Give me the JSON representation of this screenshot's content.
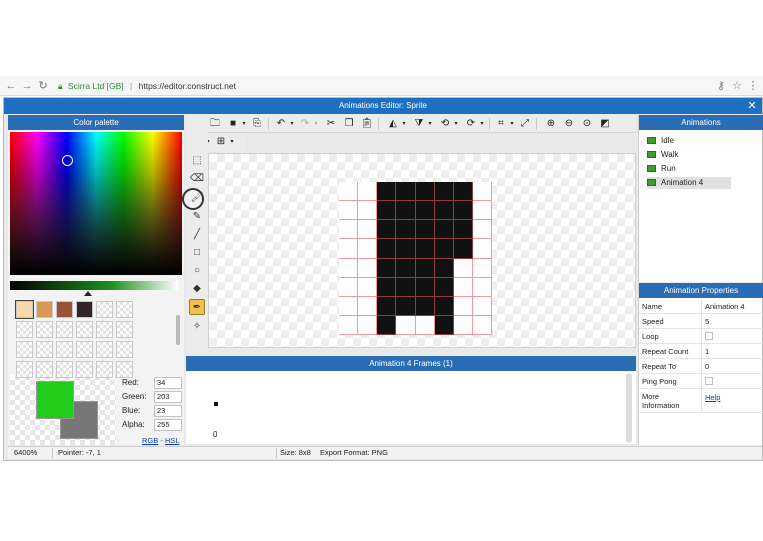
{
  "browser": {
    "org": "Scirra Ltd [GB]",
    "url": "https://editor.construct.net",
    "back_icon": "arrow-left",
    "forward_icon": "arrow-right",
    "reload_icon": "reload"
  },
  "editor": {
    "title": "Animations Editor: Sprite",
    "close_glyph": "✕"
  },
  "palette": {
    "title": "Color palette",
    "swatches": [
      "#fad6aa",
      "#d69a55",
      "#9c5239",
      "#322326"
    ],
    "selected_swatch": 0,
    "primary_color": "#22cb17",
    "secondary_color": "#777777",
    "red_label": "Red:",
    "red": "34",
    "green_label": "Green:",
    "green": "203",
    "blue_label": "Blue:",
    "blue": "23",
    "alpha_label": "Alpha:",
    "alpha": "255",
    "mode_rgb": "RGB",
    "mode_sep": " - ",
    "mode_hsl": "HSL"
  },
  "tools": [
    "select-rect",
    "eraser",
    "brush",
    "line",
    "rectangle",
    "ellipse",
    "fill",
    "color-picker",
    "image-point"
  ],
  "active_tool": "color-picker",
  "toolbar": [
    "new",
    "open",
    "save",
    "export",
    "undo",
    "redo",
    "cut",
    "copy",
    "paste",
    "mirror",
    "flip",
    "rotate-ccw",
    "rotate-cw",
    "crop",
    "resize",
    "zoom-in",
    "zoom-out",
    "zoom-reset",
    "background"
  ],
  "canvas": {
    "grid_size": 8,
    "pixels": [
      "00111110",
      "00111110",
      "00111110",
      "00111110",
      "00111100",
      "00111100",
      "00111100",
      "00100100"
    ]
  },
  "frames": {
    "title": "Animation 4 Frames (1)",
    "first_index": "0"
  },
  "animations": {
    "title": "Animations",
    "items": [
      {
        "label": "Idle"
      },
      {
        "label": "Walk"
      },
      {
        "label": "Run"
      },
      {
        "label": "Animation 4"
      }
    ],
    "selected": 3
  },
  "properties": {
    "title": "Animation Properties",
    "name_label": "Name",
    "name_value": "Animation 4",
    "speed_label": "Speed",
    "speed_value": "5",
    "loop_label": "Loop",
    "loop_checked": false,
    "repeat_count_label": "Repeat Count",
    "repeat_count_value": "1",
    "repeat_to_label": "Repeat To",
    "repeat_to_value": "0",
    "ping_pong_label": "Ping Pong",
    "ping_pong_checked": false,
    "more_label_1": "More",
    "more_label_2": "Information",
    "help_link": "Help"
  },
  "status": {
    "zoom": "6400%",
    "pointer": "Pointer: -7, 1",
    "size": "Size: 8x8",
    "export_format": "Export Format: PNG"
  }
}
